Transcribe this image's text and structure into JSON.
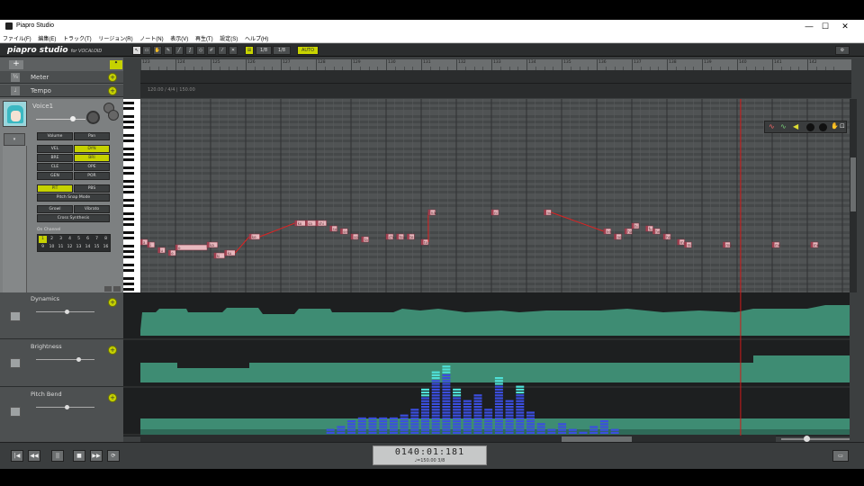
{
  "window": {
    "title": "Piapro Studio",
    "controls": [
      "—",
      "☐",
      "✕"
    ]
  },
  "menu": [
    "ファイル(F)",
    "編集(E)",
    "トラック(T)",
    "リージョン(R)",
    "ノート(N)",
    "表示(V)",
    "再生(T)",
    "設定(S)",
    "ヘルプ(H)"
  ],
  "toolbar": {
    "logo": "piapro studio",
    "logo_sub": "for VOCALOID",
    "quantize": "1/8",
    "note_len": "1/8",
    "auto_label": "AUTO"
  },
  "tracks": {
    "add": "+",
    "meter": "Meter",
    "tempo": "Tempo",
    "tempo_marker": "120.00 / 4/4 | 150.00",
    "voice_name": "Voice1",
    "mix": [
      "Volume",
      "Pan"
    ],
    "params": [
      [
        "VEL",
        "DYN"
      ],
      [
        "BRE",
        "BRI"
      ],
      [
        "CLE",
        "OPE"
      ],
      [
        "GEN",
        "POR"
      ]
    ],
    "pit_pbs": [
      "PIT",
      "PBS"
    ],
    "pitch_snap": "Pitch Snap Mode",
    "growl_vibrato": [
      "Growl",
      "Vibrato"
    ],
    "cross_synth": "Cross Synthesis",
    "channels_label": "On Channel",
    "channels": [
      "1",
      "2",
      "3",
      "4",
      "5",
      "6",
      "7",
      "8",
      "9",
      "10",
      "11",
      "12",
      "13",
      "14",
      "15",
      "16"
    ],
    "lanes": [
      "Dynamics",
      "Brightness",
      "Pitch Bend"
    ]
  },
  "ruler": {
    "bars": [
      "123",
      "124",
      "125",
      "126",
      "127",
      "128",
      "129",
      "130",
      "131",
      "132",
      "133",
      "134",
      "135",
      "136",
      "137",
      "138",
      "139",
      "140",
      "141",
      "142"
    ]
  },
  "piano_roll": {
    "notes": [
      {
        "lane": 47,
        "bar": 123.0,
        "len": 0.2,
        "lyric": "a"
      },
      {
        "lane": 48,
        "bar": 123.2,
        "len": 0.2,
        "lyric": "i"
      },
      {
        "lane": 50,
        "bar": 123.5,
        "len": 0.2,
        "lyric": "u"
      },
      {
        "lane": 51,
        "bar": 123.8,
        "len": 0.2,
        "lyric": "e"
      },
      {
        "lane": 49,
        "bar": 124.0,
        "len": 0.9,
        "lyric": "o"
      },
      {
        "lane": 48,
        "bar": 124.9,
        "len": 0.3,
        "lyric": "ka"
      },
      {
        "lane": 52,
        "bar": 125.1,
        "len": 0.3,
        "lyric": "ki"
      },
      {
        "lane": 51,
        "bar": 125.4,
        "len": 0.3,
        "lyric": "ku"
      },
      {
        "lane": 45,
        "bar": 126.1,
        "len": 0.3,
        "lyric": "ke"
      },
      {
        "lane": 40,
        "bar": 127.4,
        "len": 0.3,
        "lyric": "ko"
      },
      {
        "lane": 40,
        "bar": 127.7,
        "len": 0.3,
        "lyric": "sa"
      },
      {
        "lane": 40,
        "bar": 128.0,
        "len": 0.3,
        "lyric": "shi"
      },
      {
        "lane": 42,
        "bar": 128.4,
        "len": 0.2,
        "lyric": "su"
      },
      {
        "lane": 43,
        "bar": 128.7,
        "len": 0.2,
        "lyric": "se"
      },
      {
        "lane": 45,
        "bar": 129.0,
        "len": 0.2,
        "lyric": "so"
      },
      {
        "lane": 46,
        "bar": 129.3,
        "len": 0.2,
        "lyric": "ta"
      },
      {
        "lane": 45,
        "bar": 130.0,
        "len": 0.2,
        "lyric": "chi"
      },
      {
        "lane": 45,
        "bar": 130.3,
        "len": 0.2,
        "lyric": "tsu"
      },
      {
        "lane": 45,
        "bar": 130.6,
        "len": 0.2,
        "lyric": "te"
      },
      {
        "lane": 47,
        "bar": 131.0,
        "len": 0.1,
        "lyric": "to"
      },
      {
        "lane": 36,
        "bar": 131.2,
        "len": 0.2,
        "lyric": "na"
      },
      {
        "lane": 36,
        "bar": 133.0,
        "len": 0.2,
        "lyric": "ni"
      },
      {
        "lane": 36,
        "bar": 134.5,
        "len": 0.2,
        "lyric": "nu"
      },
      {
        "lane": 43,
        "bar": 136.2,
        "len": 0.2,
        "lyric": "ne"
      },
      {
        "lane": 45,
        "bar": 136.5,
        "len": 0.2,
        "lyric": "no"
      },
      {
        "lane": 43,
        "bar": 136.8,
        "len": 0.2,
        "lyric": "ha"
      },
      {
        "lane": 41,
        "bar": 137.0,
        "len": 0.2,
        "lyric": "hi"
      },
      {
        "lane": 42,
        "bar": 137.4,
        "len": 0.2,
        "lyric": "fu"
      },
      {
        "lane": 43,
        "bar": 137.6,
        "len": 0.2,
        "lyric": "he"
      },
      {
        "lane": 45,
        "bar": 137.9,
        "len": 0.2,
        "lyric": "ho"
      },
      {
        "lane": 47,
        "bar": 138.3,
        "len": 0.2,
        "lyric": "ma"
      },
      {
        "lane": 48,
        "bar": 138.5,
        "len": 0.2,
        "lyric": "mi"
      },
      {
        "lane": 48,
        "bar": 139.6,
        "len": 0.2,
        "lyric": "mu"
      },
      {
        "lane": 48,
        "bar": 141.0,
        "len": 0.2,
        "lyric": "me"
      },
      {
        "lane": 48,
        "bar": 142.1,
        "len": 0.2,
        "lyric": "mo"
      }
    ]
  },
  "pitch_bend_bars": {
    "bars": [
      "128.3",
      "128.6",
      "128.9",
      "129.2",
      "129.5",
      "129.8",
      "130.1",
      "130.4",
      "130.7",
      "131.0",
      "131.3",
      "131.6",
      "131.9",
      "132.2",
      "132.5",
      "132.8",
      "133.1",
      "133.4",
      "133.7",
      "134.0",
      "134.3",
      "134.6",
      "134.9",
      "135.2",
      "135.5",
      "135.8",
      "136.1",
      "136.4"
    ],
    "values": [
      2,
      3,
      5,
      6,
      6,
      6,
      6,
      7,
      9,
      16,
      22,
      24,
      16,
      12,
      14,
      9,
      20,
      12,
      17,
      8,
      4,
      2,
      4,
      2,
      1,
      3,
      5,
      2
    ]
  },
  "transport": {
    "time": "0140:01:181",
    "info": "♩=150.00  3/8",
    "buttons": [
      "|◀",
      "◀◀",
      "||",
      "■",
      "▶▶",
      "⟳"
    ]
  },
  "colors": {
    "accent": "#c6d200",
    "note": "#e8b9bf",
    "lane_fill": "#3e8c73",
    "bar_fill": "#3b4ee0",
    "bar_highlight": "#4fe0d8",
    "playhead": "#d21a1a"
  }
}
